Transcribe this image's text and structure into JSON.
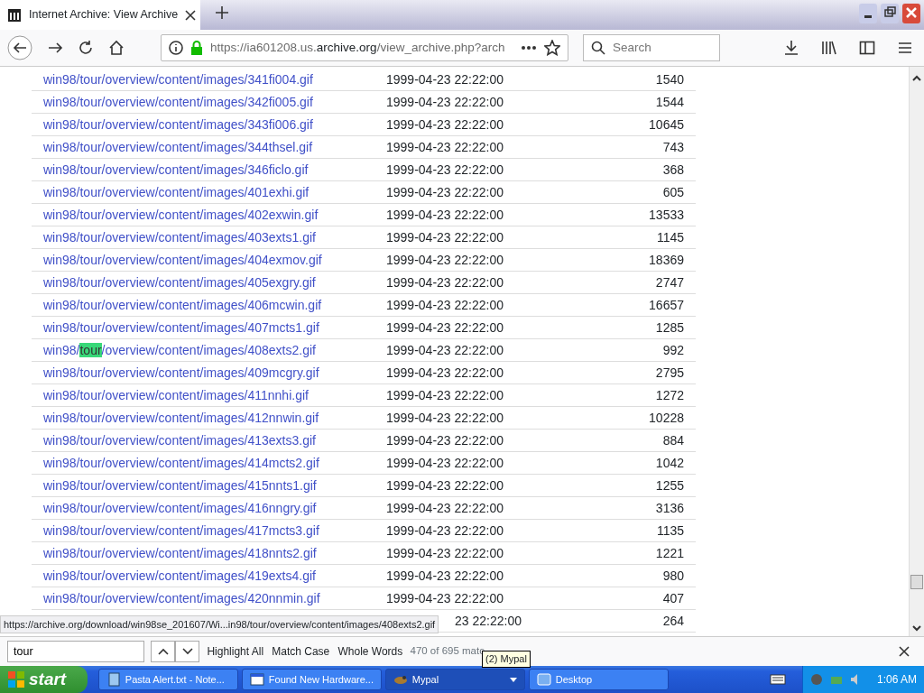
{
  "window": {
    "title": "Internet Archive: View Archive"
  },
  "toolbar": {
    "url_prefix": "https://ia601208.us.",
    "url_domain": "archive.org",
    "url_path": "/view_archive.php?arch",
    "search_placeholder": "Search"
  },
  "rows": [
    {
      "segments": [
        {
          "text": "win98/tour/overview/content/images/341fi004.gif",
          "highlighted": false
        }
      ],
      "date": "1999-04-23 22:22:00",
      "size": "1540"
    },
    {
      "segments": [
        {
          "text": "win98/tour/overview/content/images/342fi005.gif",
          "highlighted": false
        }
      ],
      "date": "1999-04-23 22:22:00",
      "size": "1544"
    },
    {
      "segments": [
        {
          "text": "win98/tour/overview/content/images/343fi006.gif",
          "highlighted": false
        }
      ],
      "date": "1999-04-23 22:22:00",
      "size": "10645"
    },
    {
      "segments": [
        {
          "text": "win98/tour/overview/content/images/344thsel.gif",
          "highlighted": false
        }
      ],
      "date": "1999-04-23 22:22:00",
      "size": "743"
    },
    {
      "segments": [
        {
          "text": "win98/tour/overview/content/images/346ficlo.gif",
          "highlighted": false
        }
      ],
      "date": "1999-04-23 22:22:00",
      "size": "368"
    },
    {
      "segments": [
        {
          "text": "win98/tour/overview/content/images/401exhi.gif",
          "highlighted": false
        }
      ],
      "date": "1999-04-23 22:22:00",
      "size": "605"
    },
    {
      "segments": [
        {
          "text": "win98/tour/overview/content/images/402exwin.gif",
          "highlighted": false
        }
      ],
      "date": "1999-04-23 22:22:00",
      "size": "13533"
    },
    {
      "segments": [
        {
          "text": "win98/tour/overview/content/images/403exts1.gif",
          "highlighted": false
        }
      ],
      "date": "1999-04-23 22:22:00",
      "size": "1145"
    },
    {
      "segments": [
        {
          "text": "win98/tour/overview/content/images/404exmov.gif",
          "highlighted": false
        }
      ],
      "date": "1999-04-23 22:22:00",
      "size": "18369"
    },
    {
      "segments": [
        {
          "text": "win98/tour/overview/content/images/405exgry.gif",
          "highlighted": false
        }
      ],
      "date": "1999-04-23 22:22:00",
      "size": "2747"
    },
    {
      "segments": [
        {
          "text": "win98/tour/overview/content/images/406mcwin.gif",
          "highlighted": false
        }
      ],
      "date": "1999-04-23 22:22:00",
      "size": "16657"
    },
    {
      "segments": [
        {
          "text": "win98/tour/overview/content/images/407mcts1.gif",
          "highlighted": false
        }
      ],
      "date": "1999-04-23 22:22:00",
      "size": "1285"
    },
    {
      "segments": [
        {
          "text": "win98/",
          "highlighted": false
        },
        {
          "text": "tour",
          "highlighted": true
        },
        {
          "text": "/overview/content/images/408exts2.gif",
          "highlighted": false
        }
      ],
      "date": "1999-04-23 22:22:00",
      "size": "992"
    },
    {
      "segments": [
        {
          "text": "win98/tour/overview/content/images/409mcgry.gif",
          "highlighted": false
        }
      ],
      "date": "1999-04-23 22:22:00",
      "size": "2795"
    },
    {
      "segments": [
        {
          "text": "win98/tour/overview/content/images/411nnhi.gif",
          "highlighted": false
        }
      ],
      "date": "1999-04-23 22:22:00",
      "size": "1272"
    },
    {
      "segments": [
        {
          "text": "win98/tour/overview/content/images/412nnwin.gif",
          "highlighted": false
        }
      ],
      "date": "1999-04-23 22:22:00",
      "size": "10228"
    },
    {
      "segments": [
        {
          "text": "win98/tour/overview/content/images/413exts3.gif",
          "highlighted": false
        }
      ],
      "date": "1999-04-23 22:22:00",
      "size": "884"
    },
    {
      "segments": [
        {
          "text": "win98/tour/overview/content/images/414mcts2.gif",
          "highlighted": false
        }
      ],
      "date": "1999-04-23 22:22:00",
      "size": "1042"
    },
    {
      "segments": [
        {
          "text": "win98/tour/overview/content/images/415nnts1.gif",
          "highlighted": false
        }
      ],
      "date": "1999-04-23 22:22:00",
      "size": "1255"
    },
    {
      "segments": [
        {
          "text": "win98/tour/overview/content/images/416nngry.gif",
          "highlighted": false
        }
      ],
      "date": "1999-04-23 22:22:00",
      "size": "3136"
    },
    {
      "segments": [
        {
          "text": "win98/tour/overview/content/images/417mcts3.gif",
          "highlighted": false
        }
      ],
      "date": "1999-04-23 22:22:00",
      "size": "1135"
    },
    {
      "segments": [
        {
          "text": "win98/tour/overview/content/images/418nnts2.gif",
          "highlighted": false
        }
      ],
      "date": "1999-04-23 22:22:00",
      "size": "1221"
    },
    {
      "segments": [
        {
          "text": "win98/tour/overview/content/images/419exts4.gif",
          "highlighted": false
        }
      ],
      "date": "1999-04-23 22:22:00",
      "size": "980"
    },
    {
      "segments": [
        {
          "text": "win98/tour/overview/content/images/420nnmin.gif",
          "highlighted": false
        }
      ],
      "date": "1999-04-23 22:22:00",
      "size": "407"
    },
    {
      "segments": [],
      "date": "23 22:22:00",
      "size": "264"
    }
  ],
  "status_link": "https://archive.org/download/win98se_201607/Wi...in98/tour/overview/content/images/408exts2.gif",
  "find_bar": {
    "value": "tour",
    "options": [
      {
        "label": "Highlight All"
      },
      {
        "label": "Match Case"
      },
      {
        "label": "Whole Words"
      }
    ],
    "matches": "470 of 695 matc"
  },
  "tooltip": "(2) Mypal",
  "taskbar": {
    "start": "start",
    "tasks": [
      {
        "label": "Pasta Alert.txt - Note...",
        "selected": false,
        "kind": "notepad"
      },
      {
        "label": "Found New Hardware...",
        "selected": false,
        "kind": "window"
      },
      {
        "label": "Mypal",
        "selected": true,
        "kind": "browser"
      },
      {
        "label": "Desktop",
        "selected": false,
        "kind": "desktop"
      }
    ],
    "clock": "1:06 AM"
  }
}
